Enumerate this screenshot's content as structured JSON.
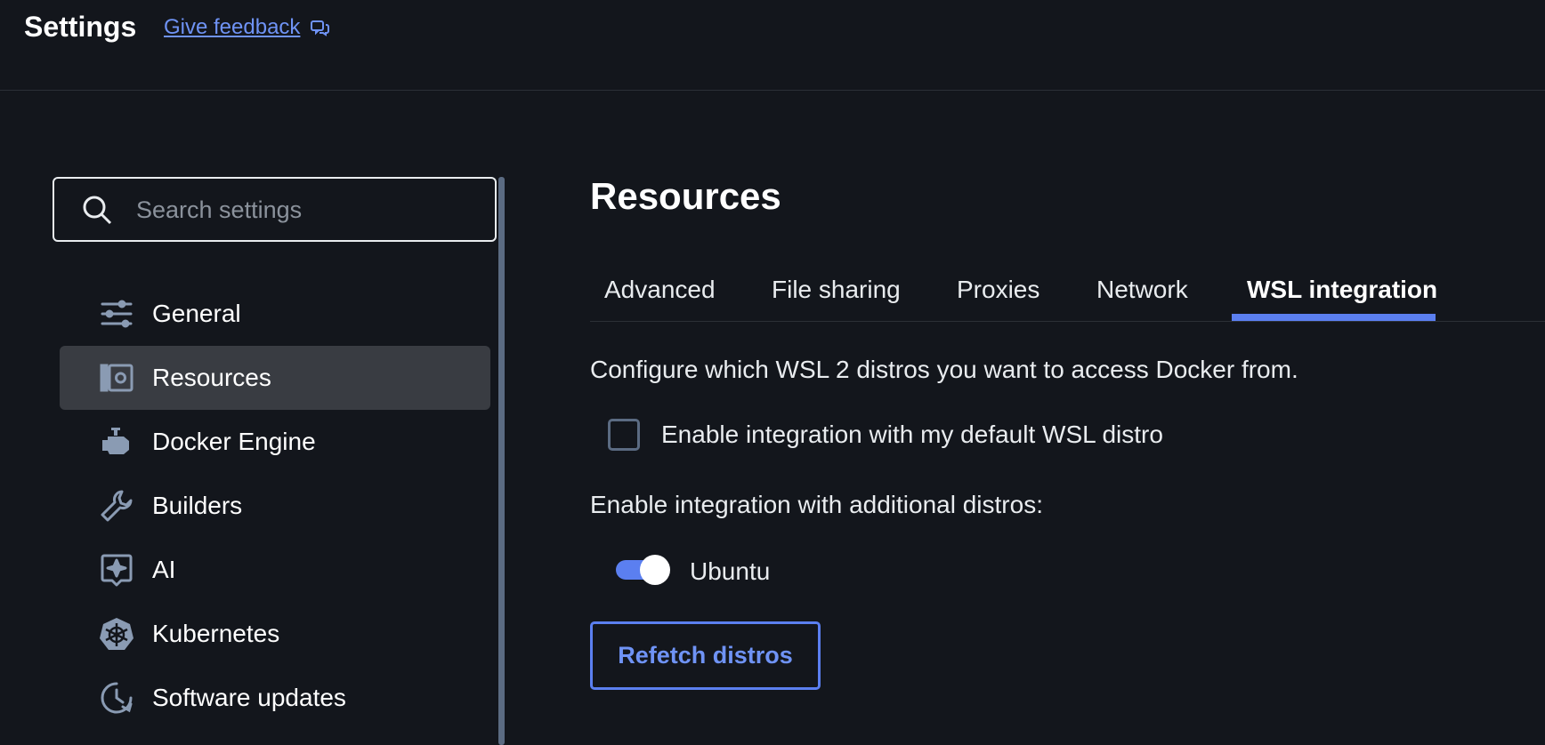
{
  "header": {
    "title": "Settings",
    "feedback_label": "Give feedback"
  },
  "sidebar": {
    "search_placeholder": "Search settings",
    "items": [
      {
        "label": "General",
        "icon": "sliders-icon"
      },
      {
        "label": "Resources",
        "icon": "resources-icon",
        "active": true
      },
      {
        "label": "Docker Engine",
        "icon": "engine-icon"
      },
      {
        "label": "Builders",
        "icon": "wrench-icon"
      },
      {
        "label": "AI",
        "icon": "ai-sparkle-icon"
      },
      {
        "label": "Kubernetes",
        "icon": "kubernetes-icon"
      },
      {
        "label": "Software updates",
        "icon": "clock-update-icon"
      }
    ]
  },
  "main": {
    "heading": "Resources",
    "tabs": [
      {
        "label": "Advanced"
      },
      {
        "label": "File sharing"
      },
      {
        "label": "Proxies"
      },
      {
        "label": "Network"
      },
      {
        "label": "WSL integration",
        "active": true
      }
    ],
    "description": "Configure which WSL 2 distros you want to access Docker from.",
    "default_distro": {
      "label": "Enable integration with my default WSL distro",
      "checked": false
    },
    "additional_heading": "Enable integration with additional distros:",
    "distros": [
      {
        "name": "Ubuntu",
        "enabled": true
      }
    ],
    "refetch_label": "Refetch distros"
  },
  "colors": {
    "background": "#13161c",
    "accent": "#5b7ff0",
    "link": "#6f93f5",
    "active_nav": "#393c42",
    "icon": "#8a9bb3"
  }
}
